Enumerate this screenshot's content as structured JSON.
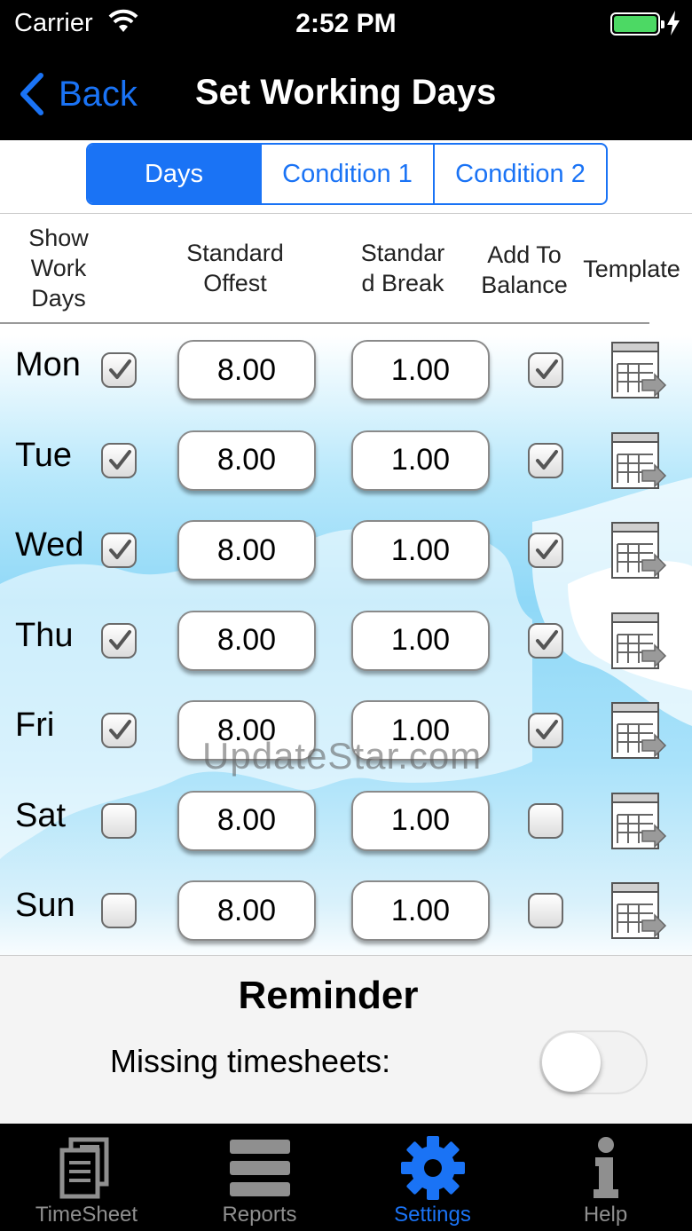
{
  "status": {
    "carrier": "Carrier",
    "time": "2:52 PM"
  },
  "nav": {
    "back_label": "Back",
    "title": "Set Working Days"
  },
  "segments": [
    "Days",
    "Condition 1",
    "Condition 2"
  ],
  "headers": {
    "show_work_days": [
      "Show",
      "Work",
      "Days"
    ],
    "standard_offest": [
      "Standard",
      "Offest"
    ],
    "standard_break": [
      "Standar",
      "d Break"
    ],
    "add_to_balance": [
      "Add To",
      "Balance"
    ],
    "template": "Template"
  },
  "days": [
    {
      "name": "Mon",
      "show": true,
      "offest": "8.00",
      "break": "1.00",
      "add": true
    },
    {
      "name": "Tue",
      "show": true,
      "offest": "8.00",
      "break": "1.00",
      "add": true
    },
    {
      "name": "Wed",
      "show": true,
      "offest": "8.00",
      "break": "1.00",
      "add": true
    },
    {
      "name": "Thu",
      "show": true,
      "offest": "8.00",
      "break": "1.00",
      "add": true
    },
    {
      "name": "Fri",
      "show": true,
      "offest": "8.00",
      "break": "1.00",
      "add": true
    },
    {
      "name": "Sat",
      "show": false,
      "offest": "8.00",
      "break": "1.00",
      "add": false
    },
    {
      "name": "Sun",
      "show": false,
      "offest": "8.00",
      "break": "1.00",
      "add": false
    }
  ],
  "watermark": "UpdateStar.com",
  "reminder": {
    "title": "Reminder",
    "missing_label": "Missing timesheets:",
    "missing_on": false
  },
  "tabs": [
    {
      "label": "TimeSheet",
      "icon": "timesheet-icon"
    },
    {
      "label": "Reports",
      "icon": "reports-icon"
    },
    {
      "label": "Settings",
      "icon": "gear-icon",
      "active": true
    },
    {
      "label": "Help",
      "icon": "help-icon"
    }
  ],
  "colors": {
    "accent": "#1a73f5",
    "battery": "#4cd964"
  }
}
